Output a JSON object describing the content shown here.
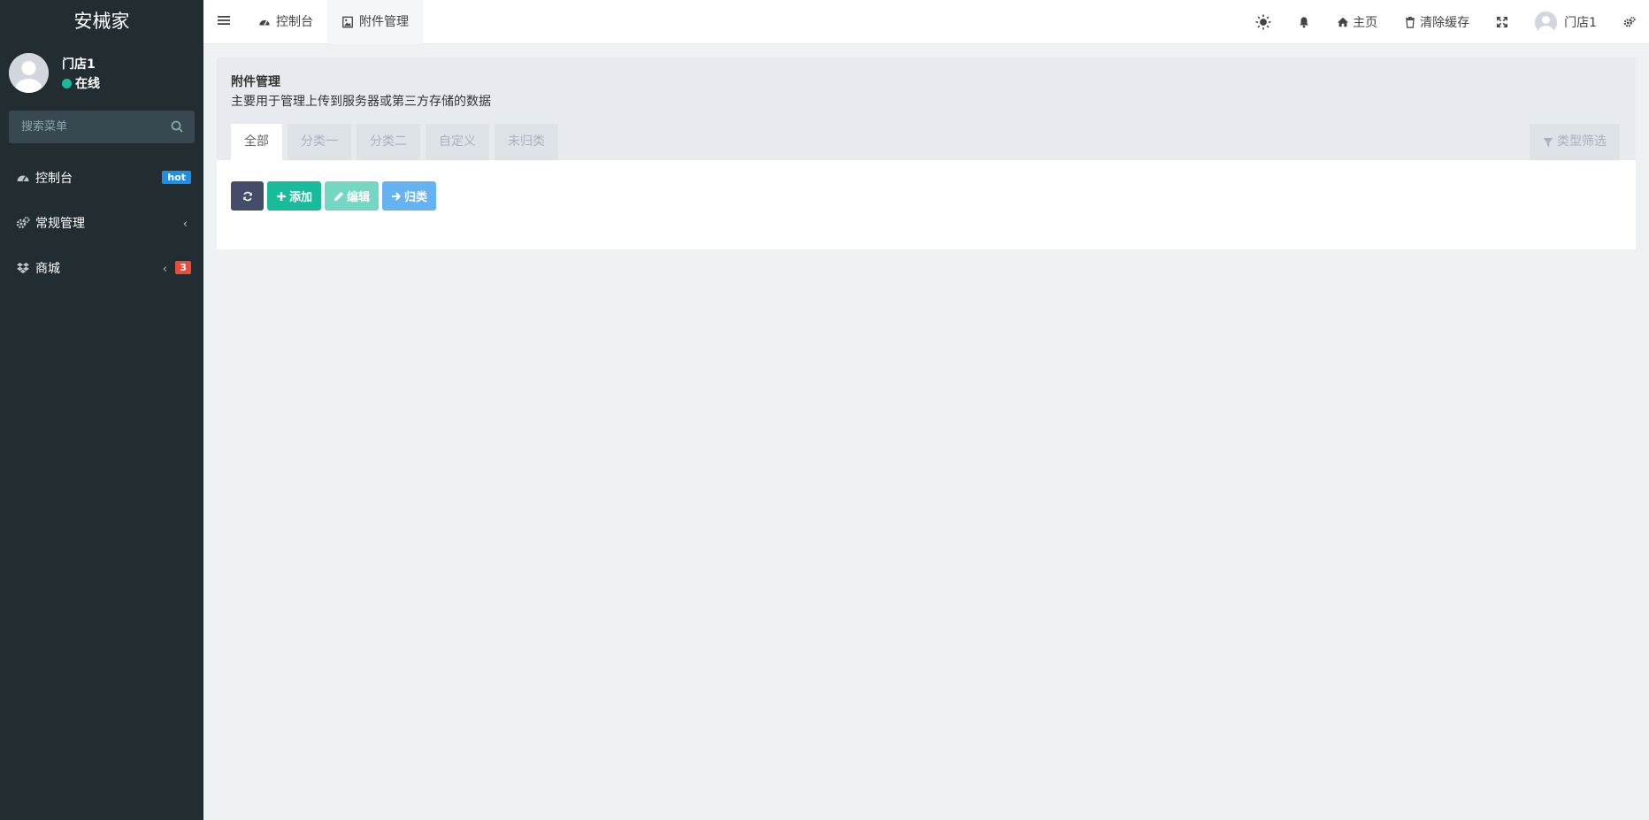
{
  "sidebar": {
    "brand": "安械家",
    "user": {
      "name": "门店1",
      "status": "在线"
    },
    "search": {
      "placeholder": "搜索菜单"
    },
    "items": [
      {
        "label": "控制台",
        "icon": "dashboard-icon",
        "badge": "hot"
      },
      {
        "label": "常规管理",
        "icon": "cogs-icon",
        "chevron": "‹"
      },
      {
        "label": "商城",
        "icon": "dropbox-icon",
        "chevron": "‹",
        "badge": "3"
      }
    ]
  },
  "header": {
    "tabs": [
      {
        "label": "控制台",
        "icon": "dashboard-icon"
      },
      {
        "label": "附件管理",
        "icon": "image-icon",
        "active": true
      }
    ],
    "home_label": "主页",
    "clear_cache_label": "清除缓存",
    "user_name": "门店1"
  },
  "panel": {
    "title": "附件管理",
    "description": "主要用于管理上传到服务器或第三方存储的数据",
    "tabs": [
      "全部",
      "分类一",
      "分类二",
      "自定义",
      "未归类"
    ],
    "filter_label": "类型筛选",
    "toolbar": {
      "add_label": "添加",
      "edit_label": "编辑",
      "classify_label": "归类"
    }
  },
  "colors": {
    "sidebar_bg": "#222d32",
    "accent_green": "#18bc9c",
    "badge_blue": "#1f8ee6",
    "badge_red": "#e74c3c",
    "refresh_btn": "#444c69",
    "classify_btn": "#66b3f2"
  }
}
